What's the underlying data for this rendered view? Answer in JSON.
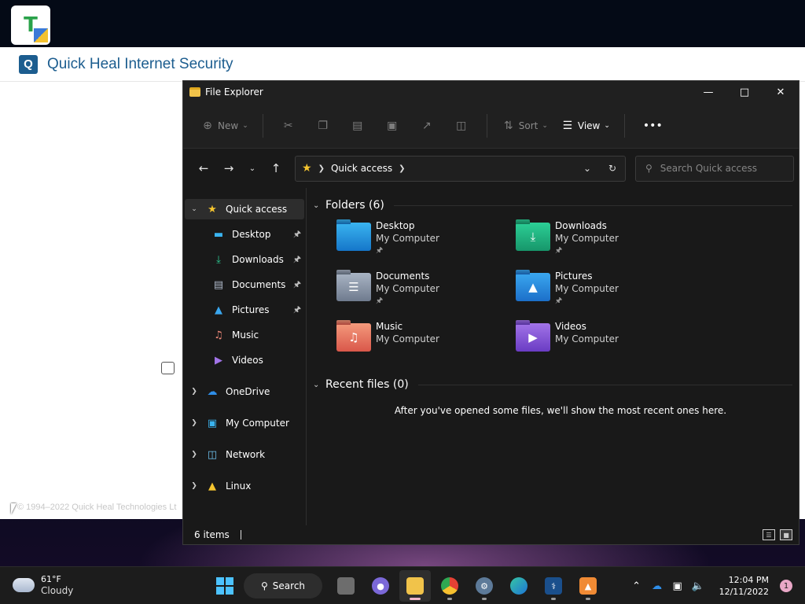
{
  "quickheal": {
    "logo_letter": "Q",
    "title": "Quick Heal Internet Security",
    "footer": "© 1994–2022 Quick Heal Technologies Lt"
  },
  "explorer": {
    "title": "File Explorer",
    "toolbar": {
      "new_label": "New",
      "sort_label": "Sort",
      "view_label": "View"
    },
    "address": {
      "location": "Quick access"
    },
    "search": {
      "placeholder": "Search Quick access"
    },
    "sidebar": {
      "quick_access": "Quick access",
      "pinned": [
        {
          "label": "Desktop"
        },
        {
          "label": "Downloads"
        },
        {
          "label": "Documents"
        },
        {
          "label": "Pictures"
        },
        {
          "label": "Music"
        },
        {
          "label": "Videos"
        }
      ],
      "roots": [
        {
          "label": "OneDrive"
        },
        {
          "label": "My Computer"
        },
        {
          "label": "Network"
        },
        {
          "label": "Linux"
        }
      ]
    },
    "folders_header": "Folders (6)",
    "folders": [
      {
        "name": "Desktop",
        "location": "My Computer"
      },
      {
        "name": "Downloads",
        "location": "My Computer"
      },
      {
        "name": "Documents",
        "location": "My Computer"
      },
      {
        "name": "Pictures",
        "location": "My Computer"
      },
      {
        "name": "Music",
        "location": "My Computer"
      },
      {
        "name": "Videos",
        "location": "My Computer"
      }
    ],
    "recent_header": "Recent files (0)",
    "recent_empty": "After you've opened some files, we'll show the most recent ones here.",
    "status": "6 items"
  },
  "taskbar": {
    "weather_temp": "61°F",
    "weather_desc": "Cloudy",
    "search_label": "Search",
    "time": "12:04 PM",
    "date": "12/11/2022",
    "notification_count": "1"
  }
}
